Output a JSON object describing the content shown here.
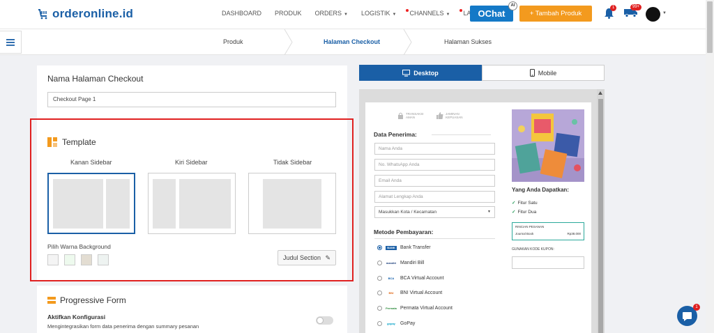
{
  "brand": {
    "logo_text": "orderonline.id"
  },
  "nav": {
    "items": [
      {
        "label": "DASHBOARD",
        "caret": false,
        "dot": false
      },
      {
        "label": "PRODUK",
        "caret": false,
        "dot": false
      },
      {
        "label": "ORDERS",
        "caret": true,
        "dot": false
      },
      {
        "label": "LOGISTIK",
        "caret": true,
        "dot": false
      },
      {
        "label": "CHANNELS",
        "caret": true,
        "dot": true
      },
      {
        "label": "LAINNYA",
        "caret": true,
        "dot": true
      }
    ],
    "ochat_label": "OChat",
    "ochat_badge": "AI",
    "tambah_label": "+ Tambah Produk",
    "bell_badge": "1",
    "truck_badge": "99+"
  },
  "breadcrumb": {
    "items": [
      "Produk",
      "Halaman Checkout",
      "Halaman Sukses"
    ],
    "active_index": 1
  },
  "form": {
    "page_name_label": "Nama Halaman Checkout",
    "page_name_value": "Checkout Page 1"
  },
  "template": {
    "title": "Template",
    "options": [
      "Kanan Sidebar",
      "Kiri Sidebar",
      "Tidak Sidebar"
    ],
    "selected_index": 0,
    "bg_label": "Pilih Warna Background",
    "bg_colors": [
      "#f4f4f4",
      "#eefaee",
      "#e3ddd2",
      "#eef3f1"
    ],
    "judul_button": "Judul Section"
  },
  "progressive": {
    "title": "Progressive Form",
    "subtitle": "Aktifkan Konfigurasi",
    "description": "Mengintegrasikan form data penerima dengan summary pesanan",
    "enabled": false
  },
  "preview_tabs": {
    "desktop": "Desktop",
    "mobile": "Mobile",
    "active": "desktop"
  },
  "preview": {
    "trust_1": "TRANSAKSI AMAN",
    "trust_2": "JAMINAN KEPUASAN",
    "penerima_heading": "Data Penerima:",
    "fields": [
      "Nama Anda",
      "No. WhatsApp Anda",
      "Email Anda",
      "Alamat Lengkap Anda"
    ],
    "kota_placeholder": "Masukkan Kota / Kecamatan",
    "payment_heading": "Metode Pembayaran:",
    "payments": [
      {
        "label": "Bank Transfer",
        "logo": "BANK",
        "selected": true
      },
      {
        "label": "Mandiri Bill",
        "logo": "mandiri",
        "selected": false
      },
      {
        "label": "BCA Virtual Account",
        "logo": "BCA",
        "selected": false
      },
      {
        "label": "BNI Virtual Account",
        "logo": "BNI",
        "selected": false
      },
      {
        "label": "Permata Virtual Account",
        "logo": "Permata",
        "selected": false
      },
      {
        "label": "GoPay",
        "logo": "gopay",
        "selected": false
      }
    ],
    "yang_heading": "Yang Anda Dapatkan:",
    "fitur": [
      "Fitur Satu",
      "Fitur Dua"
    ],
    "rincian_title": "RINCIAN PESANAN",
    "rincian_item": "Journal Book",
    "rincian_price": "Rp38.000",
    "kupon_label": "GUNAKAN KODE KUPON:"
  },
  "chat": {
    "badge": "1"
  },
  "colors": {
    "primary": "#1a5fa6",
    "accent": "#f39a1e",
    "highlight": "#e02020"
  }
}
